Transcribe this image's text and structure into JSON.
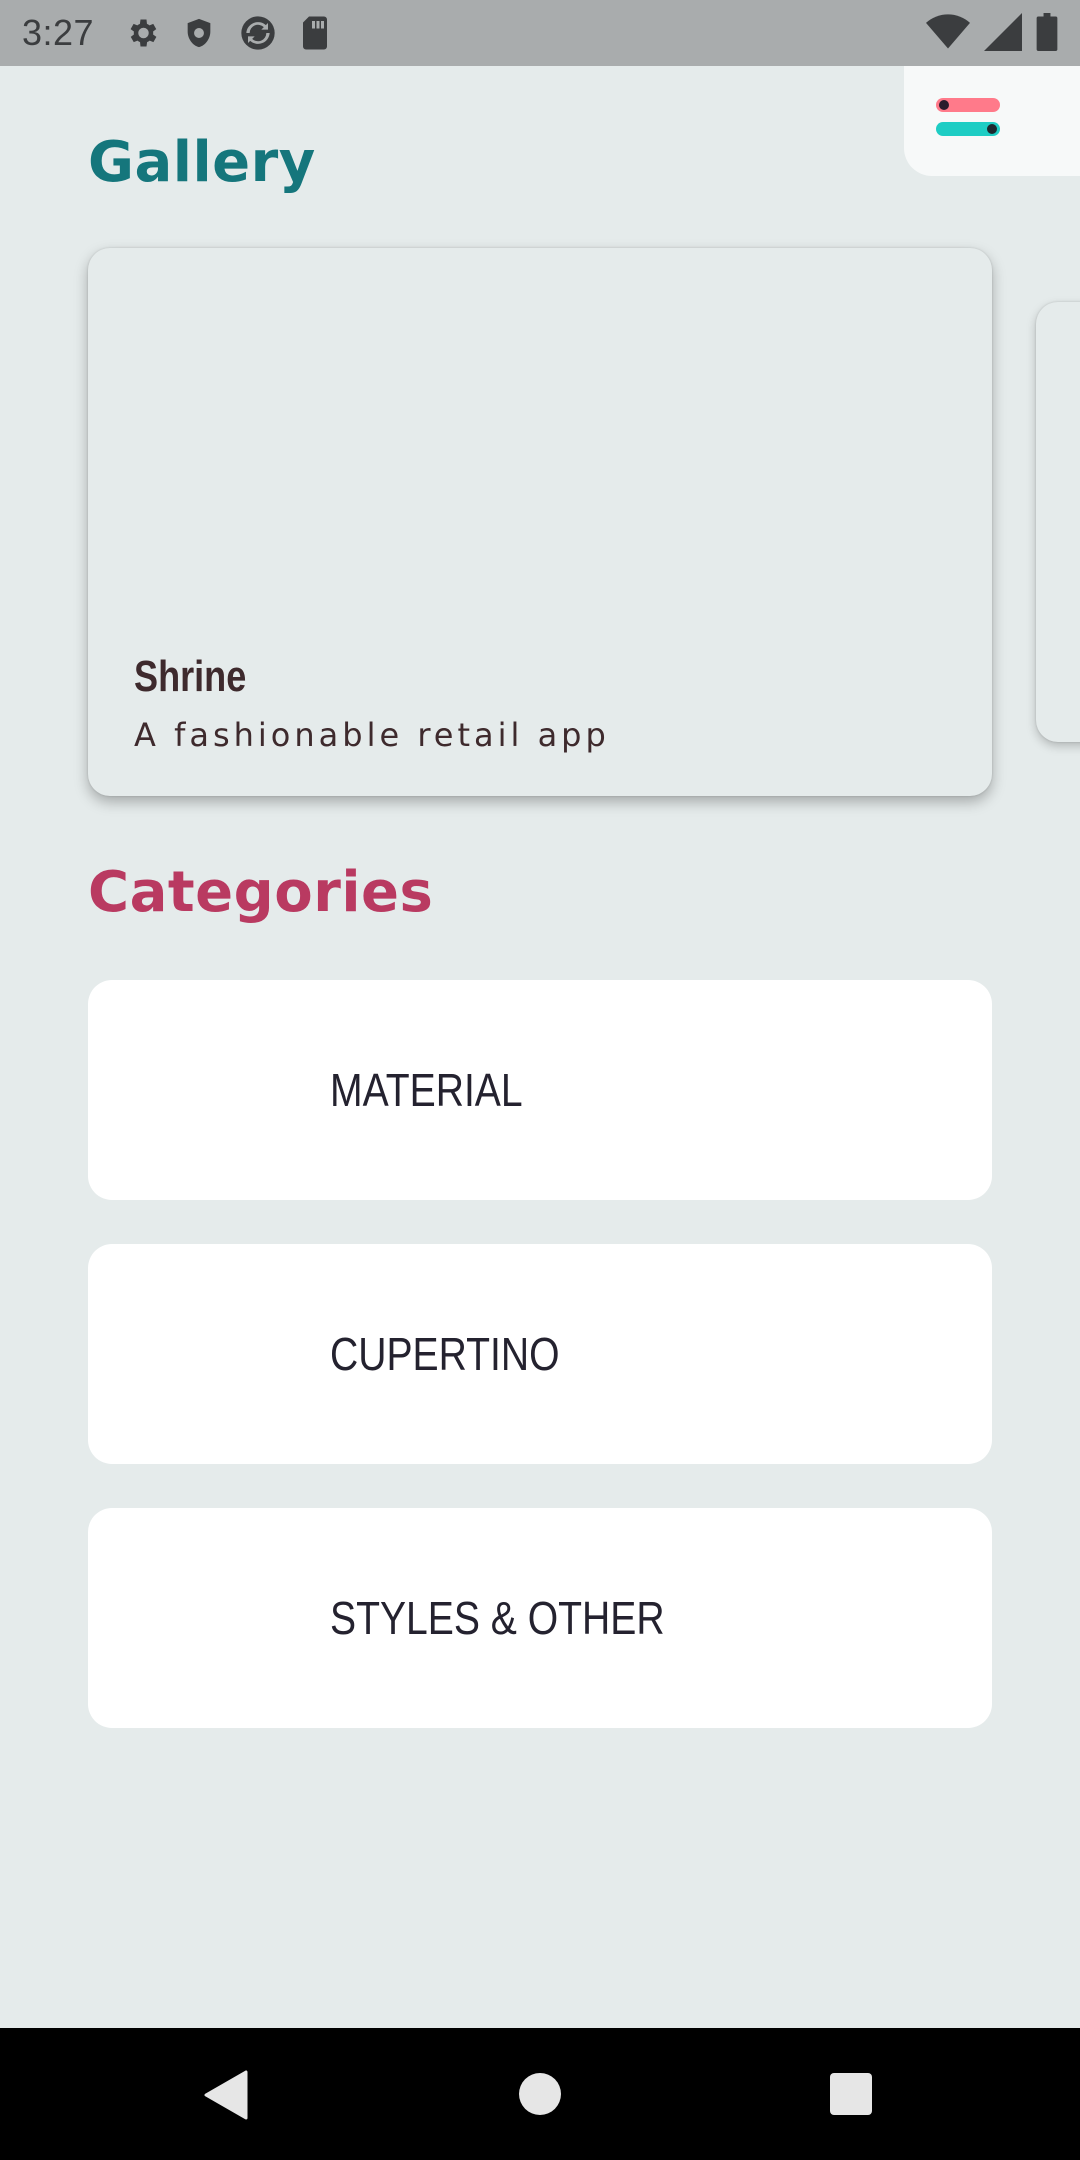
{
  "status_bar": {
    "time": "3:27",
    "left_icons": [
      "settings-icon",
      "shield-icon",
      "sync-icon",
      "sd-card-icon"
    ],
    "right_icons": [
      "wifi-icon",
      "signal-icon",
      "battery-icon"
    ]
  },
  "settings_button": {
    "icon": "settings-toggle-icon",
    "colors": [
      "#ff7a8a",
      "#1ecdc4"
    ]
  },
  "gallery": {
    "title": "Gallery",
    "title_color": "#15767c",
    "cards": [
      {
        "title": "Shrine",
        "subtitle": "A fashionable retail app"
      }
    ]
  },
  "categories": {
    "title": "Categories",
    "title_color": "#b93a61",
    "items": [
      {
        "label": "MATERIAL"
      },
      {
        "label": "CUPERTINO"
      },
      {
        "label": "STYLES & OTHER"
      }
    ]
  },
  "nav_bar": {
    "buttons": [
      "back",
      "home",
      "recents"
    ]
  }
}
